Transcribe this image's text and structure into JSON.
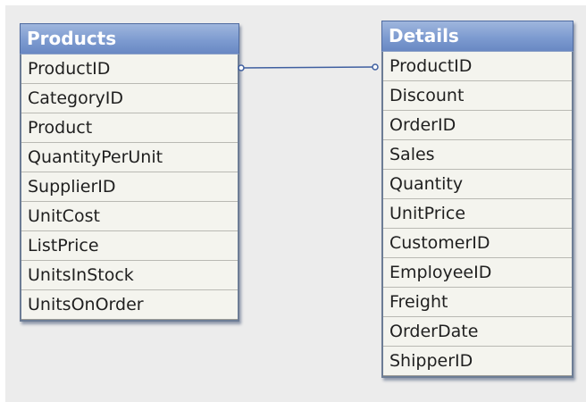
{
  "colors": {
    "canvas_background": "#ececec",
    "header_gradient_top": "#9fb6dd",
    "header_gradient_bottom": "#6988c3",
    "header_text": "#ffffff",
    "row_background": "#f4f4ee",
    "border": "#6d7d95",
    "link_line": "#3f5fa0"
  },
  "tables": [
    {
      "name": "Products",
      "fields": [
        "ProductID",
        "CategoryID",
        "Product",
        "QuantityPerUnit",
        "SupplierID",
        "UnitCost",
        "ListPrice",
        "UnitsInStock",
        "UnitsOnOrder"
      ]
    },
    {
      "name": "Details",
      "fields": [
        "ProductID",
        "Discount",
        "OrderID",
        "Sales",
        "Quantity",
        "UnitPrice",
        "CustomerID",
        "EmployeeID",
        "Freight",
        "OrderDate",
        "ShipperID"
      ]
    }
  ],
  "links": [
    {
      "from_table": "Products",
      "from_field": "ProductID",
      "to_table": "Details",
      "to_field": "ProductID"
    }
  ]
}
